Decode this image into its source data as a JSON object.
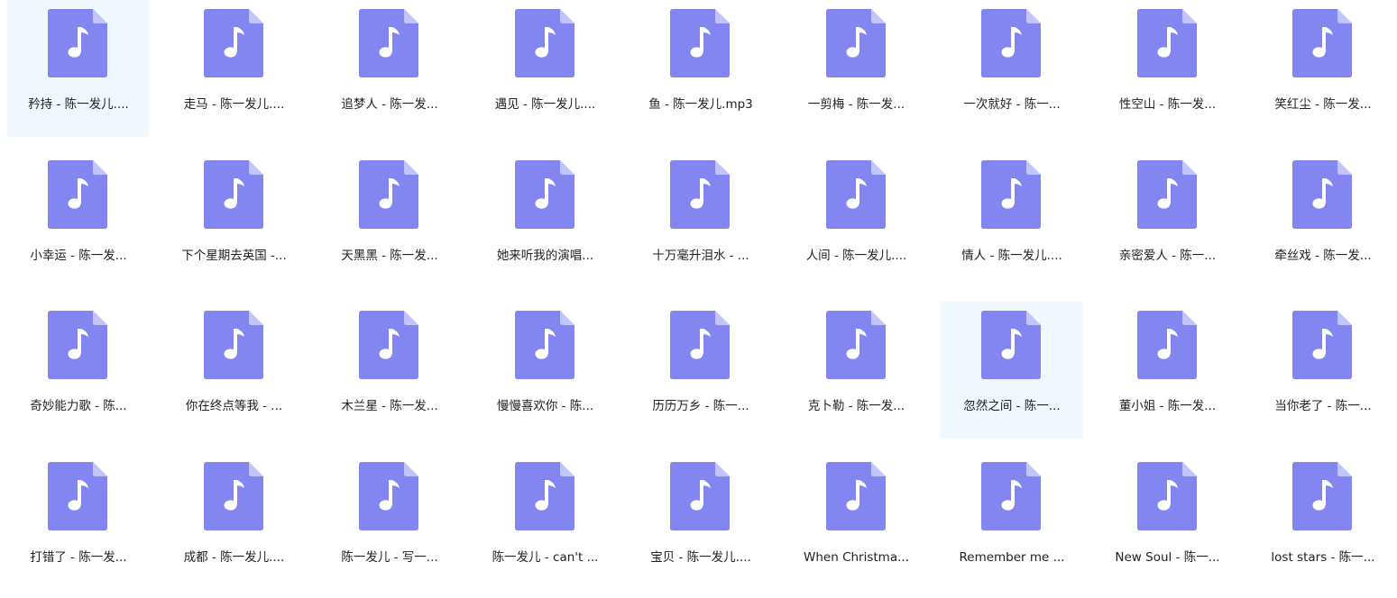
{
  "colors": {
    "icon_fill": "#8386f0",
    "icon_fold": "#c2c4fb",
    "note": "#ffffff",
    "hover_bg": "#f1f8ff",
    "label_text": "#222222"
  },
  "icon_name": "music-file-icon",
  "files": [
    {
      "label": "矜持 - 陈一发儿....",
      "highlighted": true
    },
    {
      "label": "走马 - 陈一发儿...."
    },
    {
      "label": "追梦人 - 陈一发..."
    },
    {
      "label": "遇见 - 陈一发儿...."
    },
    {
      "label": "鱼 - 陈一发儿.mp3"
    },
    {
      "label": "一剪梅 - 陈一发..."
    },
    {
      "label": "一次就好 - 陈一..."
    },
    {
      "label": "性空山 - 陈一发..."
    },
    {
      "label": "笑红尘 - 陈一发..."
    },
    {
      "label": "小幸运 - 陈一发..."
    },
    {
      "label": "下个星期去英国 -..."
    },
    {
      "label": "天黑黑 - 陈一发..."
    },
    {
      "label": "她来听我的演唱..."
    },
    {
      "label": "十万毫升泪水 - ..."
    },
    {
      "label": "人间 - 陈一发儿...."
    },
    {
      "label": "情人 - 陈一发儿...."
    },
    {
      "label": "亲密爱人 - 陈一..."
    },
    {
      "label": "牵丝戏 - 陈一发..."
    },
    {
      "label": "奇妙能力歌 - 陈..."
    },
    {
      "label": "你在终点等我 - ..."
    },
    {
      "label": "木兰星 - 陈一发..."
    },
    {
      "label": "慢慢喜欢你 - 陈..."
    },
    {
      "label": "历历万乡 - 陈一..."
    },
    {
      "label": "克卜勒 - 陈一发..."
    },
    {
      "label": "忽然之间 - 陈一...",
      "highlighted": true
    },
    {
      "label": "董小姐 - 陈一发..."
    },
    {
      "label": "当你老了 - 陈一..."
    },
    {
      "label": "打错了 - 陈一发..."
    },
    {
      "label": "成都 - 陈一发儿...."
    },
    {
      "label": "陈一发儿 - 写一..."
    },
    {
      "label": "陈一发儿 - can't ..."
    },
    {
      "label": "宝贝 - 陈一发儿...."
    },
    {
      "label": "When Christma..."
    },
    {
      "label": "Remember me ..."
    },
    {
      "label": "New Soul - 陈一..."
    },
    {
      "label": "lost stars - 陈一..."
    }
  ]
}
